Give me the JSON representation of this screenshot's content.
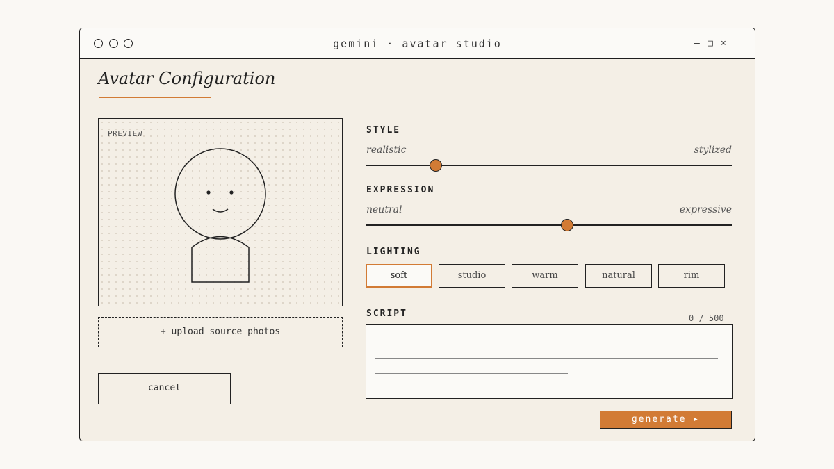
{
  "window": {
    "title": "gemini · avatar studio",
    "controls": {
      "minimize": "—",
      "maximize": "□",
      "close": "×"
    }
  },
  "page": {
    "title": "Avatar Configuration"
  },
  "preview": {
    "label": "PREVIEW"
  },
  "upload": {
    "label": "+  upload source photos"
  },
  "cancel": {
    "label": "cancel"
  },
  "style": {
    "label": "STYLE",
    "min_label": "realistic",
    "max_label": "stylized",
    "value": 0.19
  },
  "expression": {
    "label": "EXPRESSION",
    "min_label": "neutral",
    "max_label": "expressive",
    "value": 0.55
  },
  "lighting": {
    "label": "LIGHTING",
    "options": [
      "soft",
      "studio",
      "warm",
      "natural",
      "rim"
    ],
    "selected": "soft"
  },
  "script": {
    "label": "SCRIPT",
    "counter": "0 / 500",
    "value": ""
  },
  "generate": {
    "label": "generate ▸"
  },
  "colors": {
    "accent": "#d27b35",
    "background": "#f4efe6",
    "ink": "#222222"
  }
}
